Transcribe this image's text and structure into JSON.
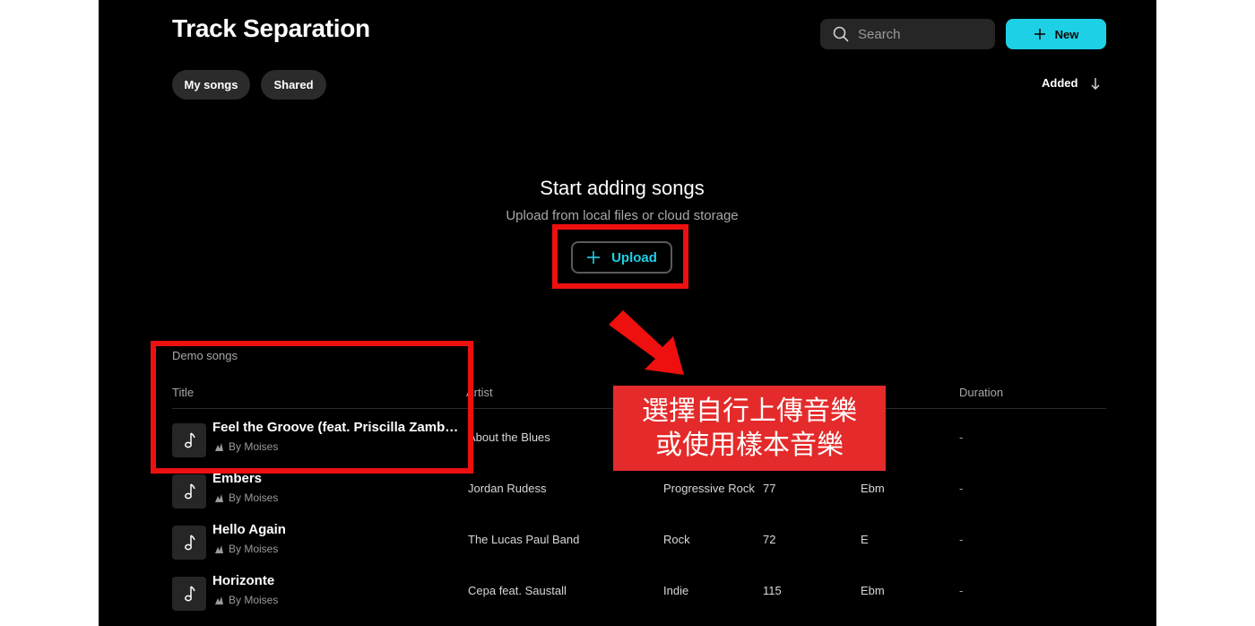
{
  "header": {
    "title": "Track Separation",
    "search_placeholder": "Search",
    "new_label": "New"
  },
  "filters": [
    {
      "label": "My songs"
    },
    {
      "label": "Shared"
    }
  ],
  "sort": {
    "label": "Added"
  },
  "empty_state": {
    "title": "Start adding songs",
    "subtitle": "Upload from local files or cloud storage",
    "upload_label": "Upload"
  },
  "annotation": {
    "callout_line1": "選擇自行上傳音樂",
    "callout_line2": "或使用樣本音樂",
    "highlight_color": "#ee0f0f"
  },
  "demo": {
    "section_label": "Demo songs",
    "columns": {
      "title": "Title",
      "artist": "Artist",
      "duration": "Duration"
    },
    "rows": [
      {
        "title": "Feel the Groove (feat. Priscilla Zamborlini)",
        "by": "By Moises",
        "artist": "About the Blues",
        "genre": "",
        "bpm": "",
        "key": "",
        "duration": "-"
      },
      {
        "title": "Embers",
        "by": "By Moises",
        "artist": "Jordan Rudess",
        "genre": "Progressive Rock",
        "bpm": "77",
        "key": "Ebm",
        "duration": "-"
      },
      {
        "title": "Hello Again",
        "by": "By Moises",
        "artist": "The Lucas Paul Band",
        "genre": "Rock",
        "bpm": "72",
        "key": "E",
        "duration": "-"
      },
      {
        "title": "Horizonte",
        "by": "By Moises",
        "artist": "Cepa feat. Saustall",
        "genre": "Indie",
        "bpm": "115",
        "key": "Ebm",
        "duration": "-"
      }
    ]
  },
  "colors": {
    "accent": "#1ed0e6",
    "background": "#000000",
    "callout": "#e42a2a"
  }
}
